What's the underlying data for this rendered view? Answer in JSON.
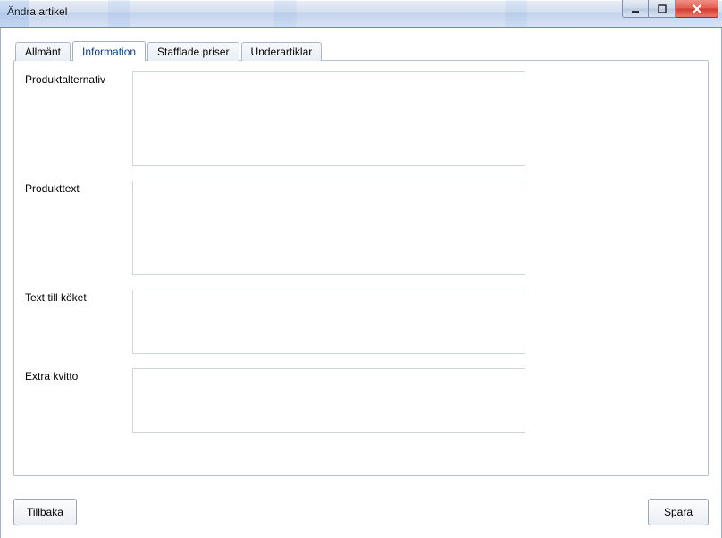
{
  "window": {
    "title": "Ändra artikel"
  },
  "tabs": [
    {
      "label": "Allmänt"
    },
    {
      "label": "Information"
    },
    {
      "label": "Stafflade priser"
    },
    {
      "label": "Underartiklar"
    }
  ],
  "activeTabIndex": 1,
  "fields": {
    "productAlternative": {
      "label": "Produktalternativ",
      "value": ""
    },
    "productText": {
      "label": "Produkttext",
      "value": ""
    },
    "kitchenText": {
      "label": "Text till köket",
      "value": ""
    },
    "extraReceipt": {
      "label": "Extra kvitto",
      "value": ""
    }
  },
  "buttons": {
    "back": "Tillbaka",
    "save": "Spara"
  }
}
